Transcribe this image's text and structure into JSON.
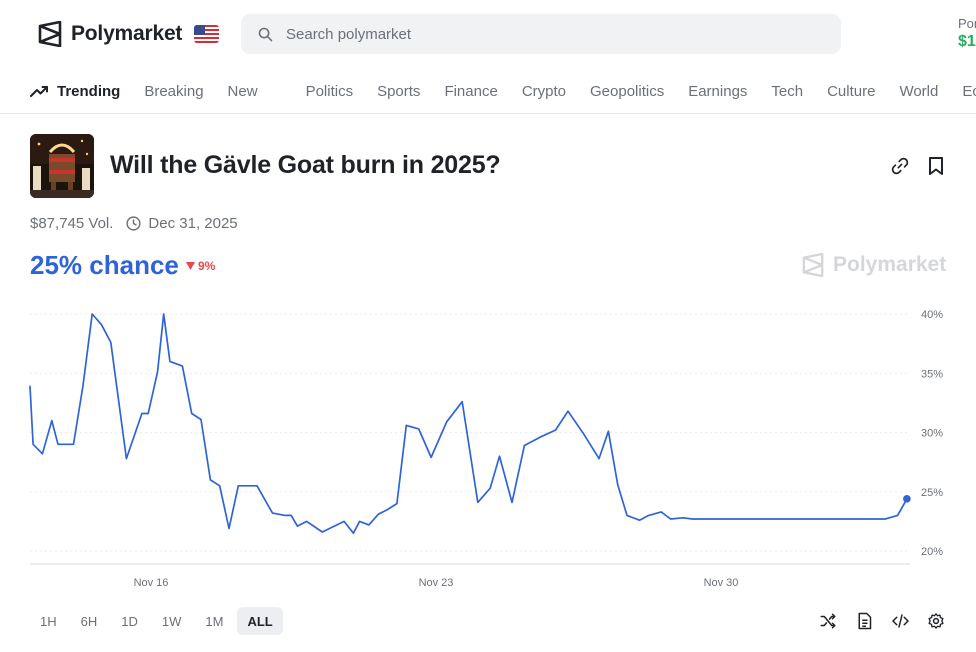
{
  "header": {
    "brand": "Polymarket",
    "search_placeholder": "Search polymarket",
    "portfolio_label": "Portfolio",
    "portfolio_value": "$1"
  },
  "nav": {
    "items": [
      {
        "label": "Trending",
        "active": true
      },
      {
        "label": "Breaking"
      },
      {
        "label": "New"
      },
      {
        "label": "Politics"
      },
      {
        "label": "Sports"
      },
      {
        "label": "Finance"
      },
      {
        "label": "Crypto"
      },
      {
        "label": "Geopolitics"
      },
      {
        "label": "Earnings"
      },
      {
        "label": "Tech"
      },
      {
        "label": "Culture"
      },
      {
        "label": "World"
      },
      {
        "label": "Economy"
      }
    ]
  },
  "market": {
    "title": "Will the Gävle Goat burn in 2025?",
    "volume": "$87,745 Vol.",
    "end_date": "Dec 31, 2025",
    "chance": "25% chance",
    "change": "9%",
    "watermark": "Polymarket"
  },
  "colors": {
    "accent": "#2f63d8",
    "negative": "#e5484d",
    "positive": "#27ae60"
  },
  "chart_data": {
    "type": "line",
    "x_tick_labels": [
      "Nov 16",
      "Nov 23",
      "Nov 30"
    ],
    "y_tick_labels": [
      "40%",
      "35%",
      "30%",
      "25%",
      "20%"
    ],
    "ylim": [
      20,
      40
    ],
    "x_range_days": [
      0,
      28.3
    ],
    "grid": true,
    "series": [
      {
        "x": [
          0,
          0.1,
          0.4,
          0.7,
          0.9,
          1.1,
          1.4,
          1.7,
          2.0,
          2.3,
          2.6,
          3.1,
          3.6,
          3.8,
          4.1,
          4.3,
          4.5,
          4.9,
          5.2,
          5.5,
          5.8,
          6.1,
          6.4,
          6.7,
          7.0,
          7.3,
          7.8,
          8.2,
          8.4,
          8.6,
          8.9,
          9.4,
          10.1,
          10.4,
          10.6,
          10.9,
          11.2,
          11.5,
          11.8,
          12.1,
          12.5,
          12.9,
          13.4,
          13.9,
          14.4,
          14.8,
          15.1,
          15.5,
          15.9,
          16.4,
          16.9,
          17.3,
          17.8,
          18.3,
          18.6,
          18.9,
          19.2,
          19.6,
          19.9,
          20.3,
          20.6,
          21.0,
          21.3,
          21.6,
          21.9,
          22.2,
          22.5,
          22.8,
          23.1,
          23.4,
          23.8,
          24.1,
          24.4,
          24.6,
          24.9,
          25.2,
          25.5,
          25.7,
          26.0,
          26.3,
          26.7,
          27.1,
          27.5,
          27.9,
          28.2
        ],
        "y": [
          33.9,
          29.0,
          28.2,
          31.0,
          29.0,
          29.0,
          29.0,
          33.9,
          40.0,
          39.1,
          37.6,
          27.8,
          31.6,
          31.6,
          35.1,
          40.0,
          36.0,
          35.6,
          31.6,
          31.1,
          26.0,
          25.5,
          21.9,
          25.5,
          25.5,
          25.5,
          23.2,
          23.0,
          23.0,
          22.1,
          22.5,
          21.6,
          22.5,
          21.5,
          22.5,
          22.2,
          23.1,
          23.5,
          24.0,
          30.6,
          30.3,
          27.9,
          30.9,
          32.6,
          24.1,
          25.3,
          28.0,
          24.1,
          28.9,
          29.6,
          30.2,
          31.8,
          29.9,
          27.8,
          30.1,
          25.6,
          23.0,
          22.6,
          23.0,
          23.3,
          22.7,
          22.8,
          22.7,
          22.7,
          22.7,
          22.7,
          22.7,
          22.7,
          22.7,
          22.7,
          22.7,
          22.7,
          22.7,
          22.7,
          22.7,
          22.7,
          22.7,
          22.7,
          22.7,
          22.7,
          22.7,
          22.7,
          22.7,
          23.0,
          24.4
        ]
      }
    ]
  },
  "controls": {
    "ranges": [
      "1H",
      "6H",
      "1D",
      "1W",
      "1M",
      "ALL"
    ],
    "active_range": "ALL"
  }
}
